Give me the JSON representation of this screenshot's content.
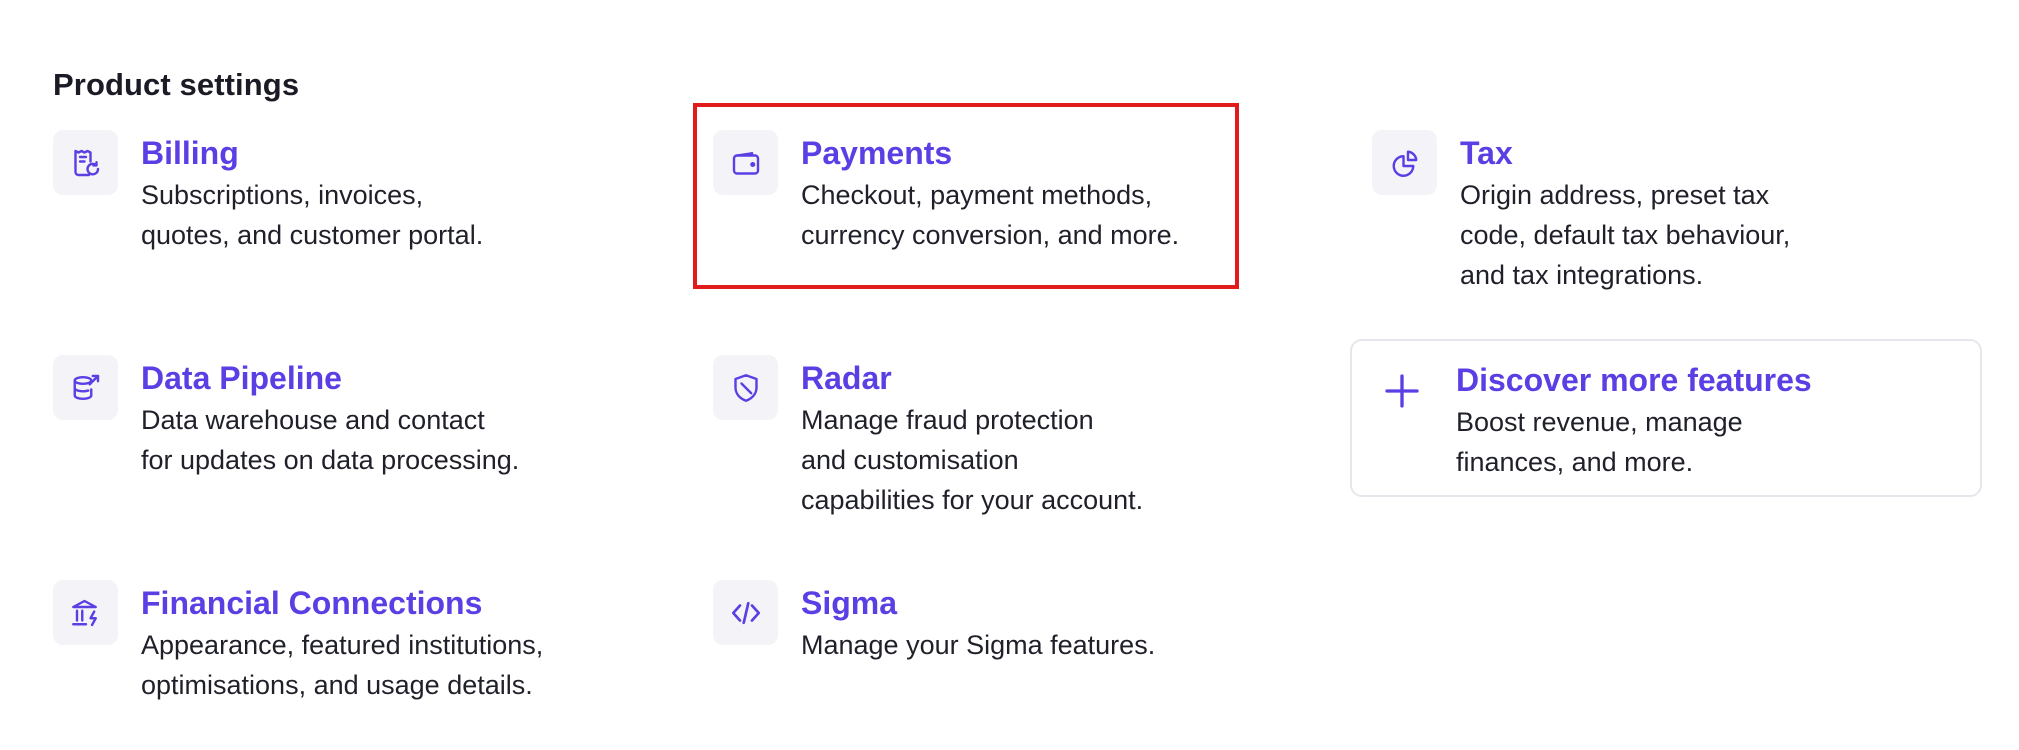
{
  "page": {
    "title": "Product settings"
  },
  "colors": {
    "accent": "#5b3fe4",
    "text": "#1f2029",
    "icon_tile_bg": "#f4f4f8",
    "highlight": "#e01b1b",
    "card_border": "#e6e7ec"
  },
  "settings": {
    "billing": {
      "icon": "receipt-refresh-icon",
      "title": "Billing",
      "desc_line1": "Subscriptions, invoices,",
      "desc_line2": "quotes, and customer portal."
    },
    "payments": {
      "icon": "wallet-icon",
      "title": "Payments",
      "desc_line1": "Checkout, payment methods,",
      "desc_line2": "currency conversion, and more."
    },
    "tax": {
      "icon": "pie-chart-icon",
      "title": "Tax",
      "desc_line1": "Origin address, preset tax",
      "desc_line2": "code, default tax behaviour,",
      "desc_line3": "and tax integrations."
    },
    "data_pipeline": {
      "icon": "database-export-icon",
      "title": "Data Pipeline",
      "desc_line1": "Data warehouse and contact",
      "desc_line2": "for updates on data processing."
    },
    "radar": {
      "icon": "shield-icon",
      "title": "Radar",
      "desc_line1": "Manage fraud protection",
      "desc_line2": "and customisation",
      "desc_line3": "capabilities for your account."
    },
    "discover": {
      "icon": "plus-icon",
      "title": "Discover more features",
      "desc_line1": "Boost revenue, manage",
      "desc_line2": "finances, and more."
    },
    "financial_connections": {
      "icon": "bank-icon",
      "title": "Financial Connections",
      "desc_line1": "Appearance, featured institutions,",
      "desc_line2": "optimisations, and usage details."
    },
    "sigma": {
      "icon": "code-icon",
      "title": "Sigma",
      "desc_line1": "Manage your Sigma features."
    }
  }
}
